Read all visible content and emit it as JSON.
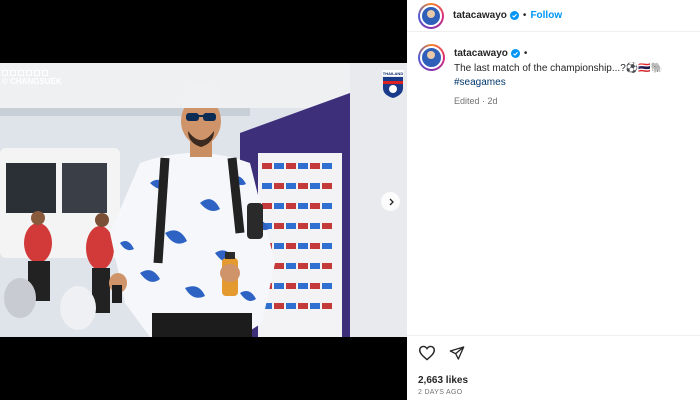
{
  "post": {
    "username": "tatacawayo",
    "follow_label": "Follow",
    "separator": "•",
    "caption_text": "The last match of the championship...?⚽🇹🇭🐘",
    "hashtag": "#seagames",
    "edited": "Edited · 2d",
    "likes": "2,663 likes",
    "date": "2 DAYS AGO"
  },
  "media": {
    "watermark": "© CHANGSUEK",
    "badge_text": "THAILAND"
  },
  "colors": {
    "link_blue": "#0095f6",
    "hashtag_blue": "#00376b",
    "verified_blue": "#0095f6"
  },
  "icons": {
    "verified": "verified-badge-icon",
    "like": "heart-icon",
    "share": "paper-plane-icon",
    "next": "chevron-right-icon"
  }
}
